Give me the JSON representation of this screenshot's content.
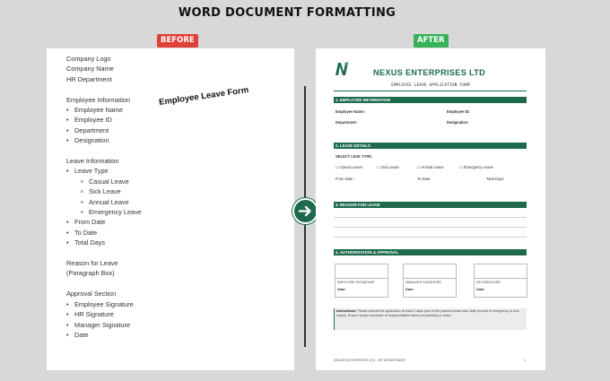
{
  "title": "WORD DOCUMENT FORMATTING",
  "badges": {
    "before": "BEFORE",
    "after": "AFTER"
  },
  "before": {
    "lines": [
      {
        "text": "Company Logo",
        "level": 0
      },
      {
        "text": "Company Name",
        "level": 0
      },
      {
        "text": "HR Department",
        "level": 0
      },
      {
        "text": "",
        "level": -1
      },
      {
        "text": "Employee Information",
        "level": 0
      },
      {
        "text": "Employee Name",
        "level": 1
      },
      {
        "text": "Employee ID",
        "level": 1
      },
      {
        "text": "Department",
        "level": 1
      },
      {
        "text": "Designation",
        "level": 1
      },
      {
        "text": "",
        "level": -1
      },
      {
        "text": "Leave Information",
        "level": 0
      },
      {
        "text": "Leave Type",
        "level": 1
      },
      {
        "text": "Casual Leave",
        "level": 2
      },
      {
        "text": "Sick Leave",
        "level": 2
      },
      {
        "text": "Annual Leave",
        "level": 2
      },
      {
        "text": "Emergency Leave",
        "level": 2
      },
      {
        "text": "From Date",
        "level": 1
      },
      {
        "text": "To Date",
        "level": 1
      },
      {
        "text": "Total Days",
        "level": 1
      },
      {
        "text": "",
        "level": -1
      },
      {
        "text": "Reason for Leave",
        "level": 0
      },
      {
        "text": "(Paragraph Box)",
        "level": 0
      },
      {
        "text": "",
        "level": -1
      },
      {
        "text": "Approval Section",
        "level": 0
      },
      {
        "text": "Employee Signature",
        "level": 1
      },
      {
        "text": "HR Signature",
        "level": 1
      },
      {
        "text": "Manager Signature",
        "level": 1
      },
      {
        "text": "Date",
        "level": 1
      }
    ],
    "annotation": "Employee Leave Form"
  },
  "after": {
    "logo_text": "N",
    "company": "NEXUS ENTERPRISES LTD",
    "form_title": "EMPLOYEE LEAVE APPLICATION FORM",
    "sections": {
      "employee": "1.  EMPLOYEE INFORMATION",
      "leave": "2.  LEAVE DETAILS",
      "reason": "3.  REASON FOR LEAVE",
      "auth": "4.  AUTHORIZATION & APPROVAL"
    },
    "employee_fields": {
      "name": "Employee Name:",
      "id": "Employee ID:",
      "department": "Department:",
      "designation": "Designation:"
    },
    "leave": {
      "select_label": "SELECT LEVE TYPE:",
      "options": [
        "Casual Leave",
        "Sick Leave",
        "Annual Leave",
        "Emergency Leave"
      ],
      "from": "From Date :",
      "to": "To Date:",
      "total": "Total Days:"
    },
    "signatures": [
      {
        "label": "EMPLOYEE SIGNATURE",
        "date": "Date:"
      },
      {
        "label": "MANAGER SIGNATURE",
        "date": "Date:"
      },
      {
        "label": "HR SIGNATURE",
        "date": "Date:"
      }
    ],
    "instructions": {
      "label": "Instructions:",
      "text": "Please submit this application at least 3 days prior to the planned leave start date (except in emergency or sick cases). Ensure proper handover of responsibilities before proceeding on leave."
    },
    "footer": {
      "left": "NEXUS ENTERPRISES LTD - HR DEPARTMENT",
      "page": "1"
    }
  },
  "colors": {
    "brand_green": "#1d6b4c",
    "before_red": "#e0403a",
    "after_green": "#35b25a"
  }
}
